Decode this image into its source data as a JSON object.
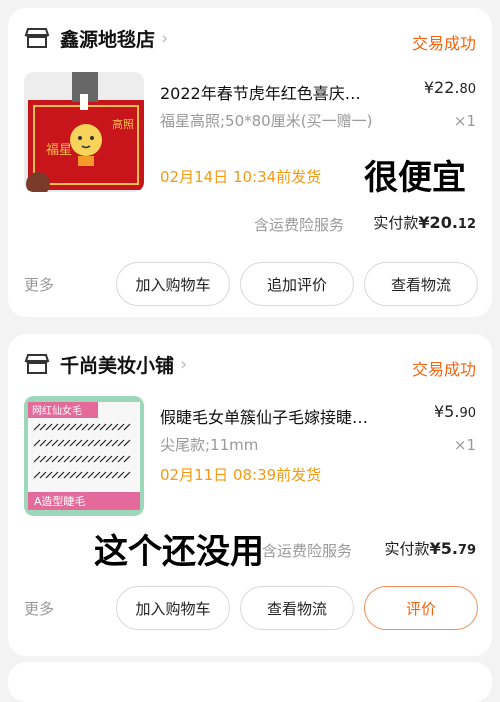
{
  "orders": [
    {
      "shop_icon": "shop-icon",
      "shop_name": "鑫源地毯店",
      "status": "交易成功",
      "title": "2022年春节虎年红色喜庆…",
      "price_main": "¥22.",
      "price_cents": "80",
      "spec": "福星高照;50*80厘米(买一赠一)",
      "qty": "×1",
      "ship": "02月14日 10:34前发货",
      "annotation": "很便宜",
      "insurance": "含运费险服务",
      "paid_label": "实付款",
      "paid_amount": "¥20.",
      "paid_cents": "12",
      "more": "更多",
      "buttons": [
        "加入购物车",
        "追加评价",
        "查看物流"
      ]
    },
    {
      "shop_icon": "shop-icon",
      "shop_name": "千尚美妆小铺",
      "status": "交易成功",
      "title": "假睫毛女单簇仙子毛嫁接睫…",
      "price_main": "¥5.",
      "price_cents": "90",
      "spec": "尖尾款;11mm",
      "qty": "×1",
      "ship": "02月11日 08:39前发货",
      "annotation": "这个还没用",
      "insurance": "含运费险服务",
      "paid_label": "实付款",
      "paid_amount": "¥5.",
      "paid_cents": "79",
      "more": "更多",
      "buttons": [
        "加入购物车",
        "查看物流",
        "评价"
      ]
    }
  ],
  "thumb1": {
    "left_text": "福星",
    "right_text": "高照",
    "colors": {
      "mat": "#c8141b",
      "floor": "#eeeeee"
    }
  },
  "thumb2": {
    "top_text": "网红仙女毛",
    "bottom_text": "A造型睫毛",
    "colors": {
      "frame": "#9bd7b8",
      "accent": "#e36a9a"
    }
  },
  "colors": {
    "accent": "#f2640f",
    "ship": "#f29a12"
  }
}
